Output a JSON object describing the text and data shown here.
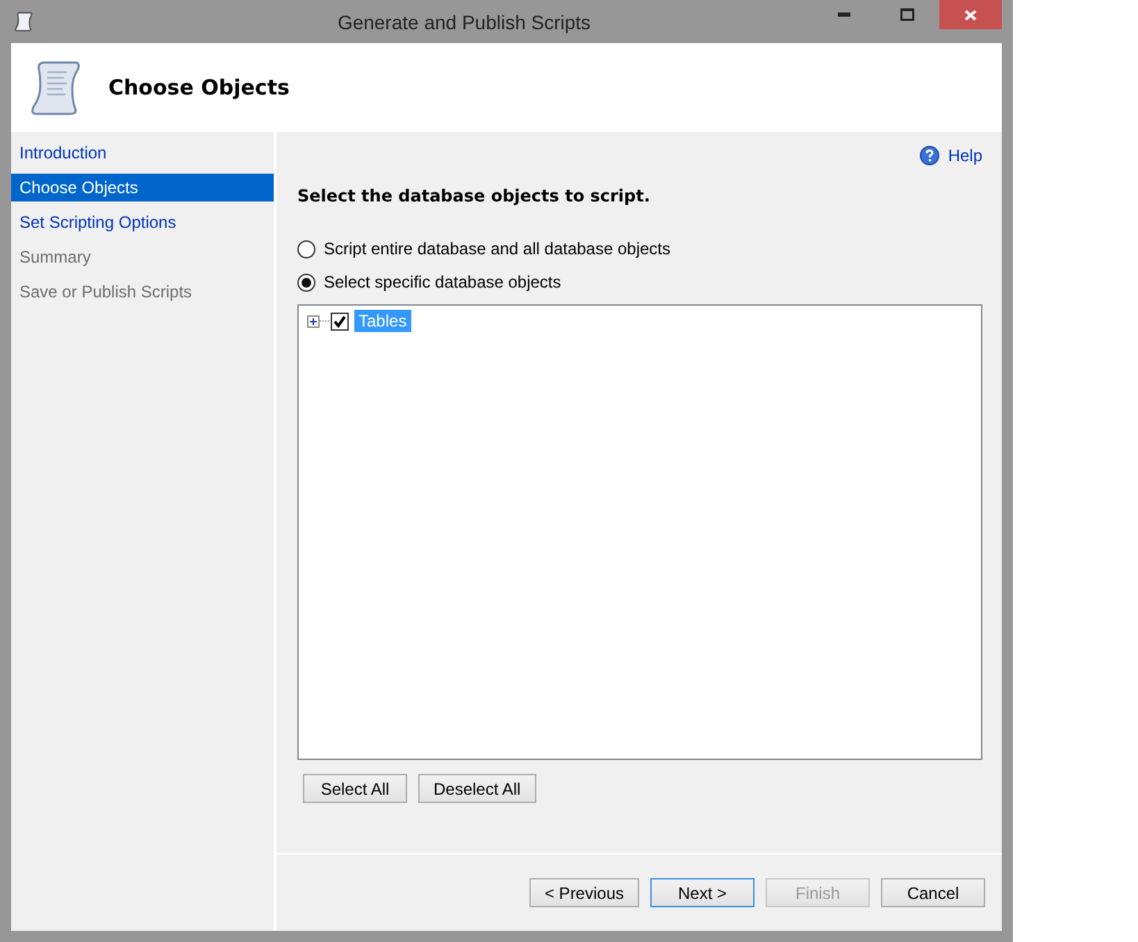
{
  "window": {
    "title": "Generate and Publish Scripts"
  },
  "header": {
    "title": "Choose Objects"
  },
  "sidebar": {
    "items": [
      {
        "label": "Introduction",
        "selected": false,
        "disabled": false
      },
      {
        "label": "Choose Objects",
        "selected": true,
        "disabled": false
      },
      {
        "label": "Set Scripting Options",
        "selected": false,
        "disabled": false
      },
      {
        "label": "Summary",
        "selected": false,
        "disabled": true
      },
      {
        "label": "Save or Publish Scripts",
        "selected": false,
        "disabled": true
      }
    ]
  },
  "help": {
    "label": "Help"
  },
  "instruction": "Select the database objects to script.",
  "options": [
    {
      "label": "Script entire database and all database objects",
      "selected": false
    },
    {
      "label": "Select specific database objects",
      "selected": true
    }
  ],
  "tree": {
    "items": [
      {
        "label": "Tables",
        "checked": true,
        "expanded": false,
        "selected": true
      }
    ]
  },
  "tree_buttons": [
    {
      "label": "Select All"
    },
    {
      "label": "Deselect All"
    }
  ],
  "footer_buttons": [
    {
      "label": "< Previous",
      "disabled": false,
      "default": false
    },
    {
      "label": "Next >",
      "disabled": false,
      "default": true
    },
    {
      "label": "Finish",
      "disabled": true,
      "default": false
    },
    {
      "label": "Cancel",
      "disabled": false,
      "default": false
    }
  ]
}
